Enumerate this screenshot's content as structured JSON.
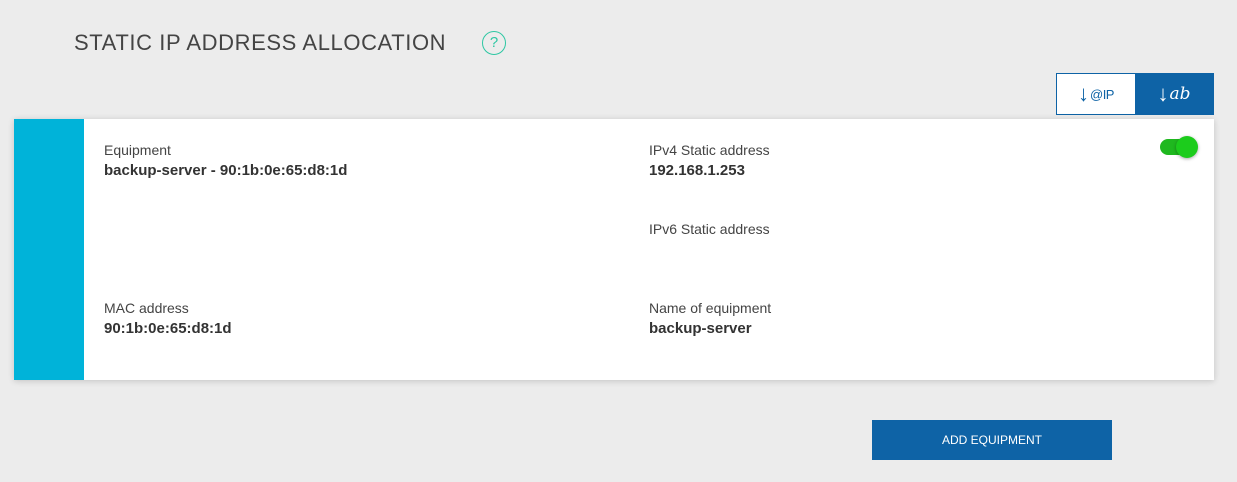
{
  "page": {
    "title": "STATIC IP ADDRESS ALLOCATION",
    "help_icon": "question-mark-icon",
    "help_glyph": "?"
  },
  "sort": {
    "by_ip": {
      "arrow": "↓",
      "label": "@IP",
      "active": false
    },
    "by_name": {
      "arrow": "↓",
      "label": "ab",
      "active": true
    }
  },
  "equipment_card": {
    "enabled": true,
    "equipment_label": "Equipment",
    "equipment_value": "backup-server - 90:1b:0e:65:d8:1d",
    "mac_label": "MAC address",
    "mac_value": "90:1b:0e:65:d8:1d",
    "ipv4_label": "IPv4 Static address",
    "ipv4_value": "192.168.1.253",
    "ipv6_label": "IPv6 Static address",
    "ipv6_value": "",
    "name_label": "Name of equipment",
    "name_value": "backup-server"
  },
  "actions": {
    "add_equipment": "ADD EQUIPMENT"
  },
  "colors": {
    "background": "#ececec",
    "accent_blue": "#0e63a6",
    "card_stripe": "#00b3d9",
    "toggle_on": "#1ccc1c",
    "help_green": "#2ec7a3"
  }
}
